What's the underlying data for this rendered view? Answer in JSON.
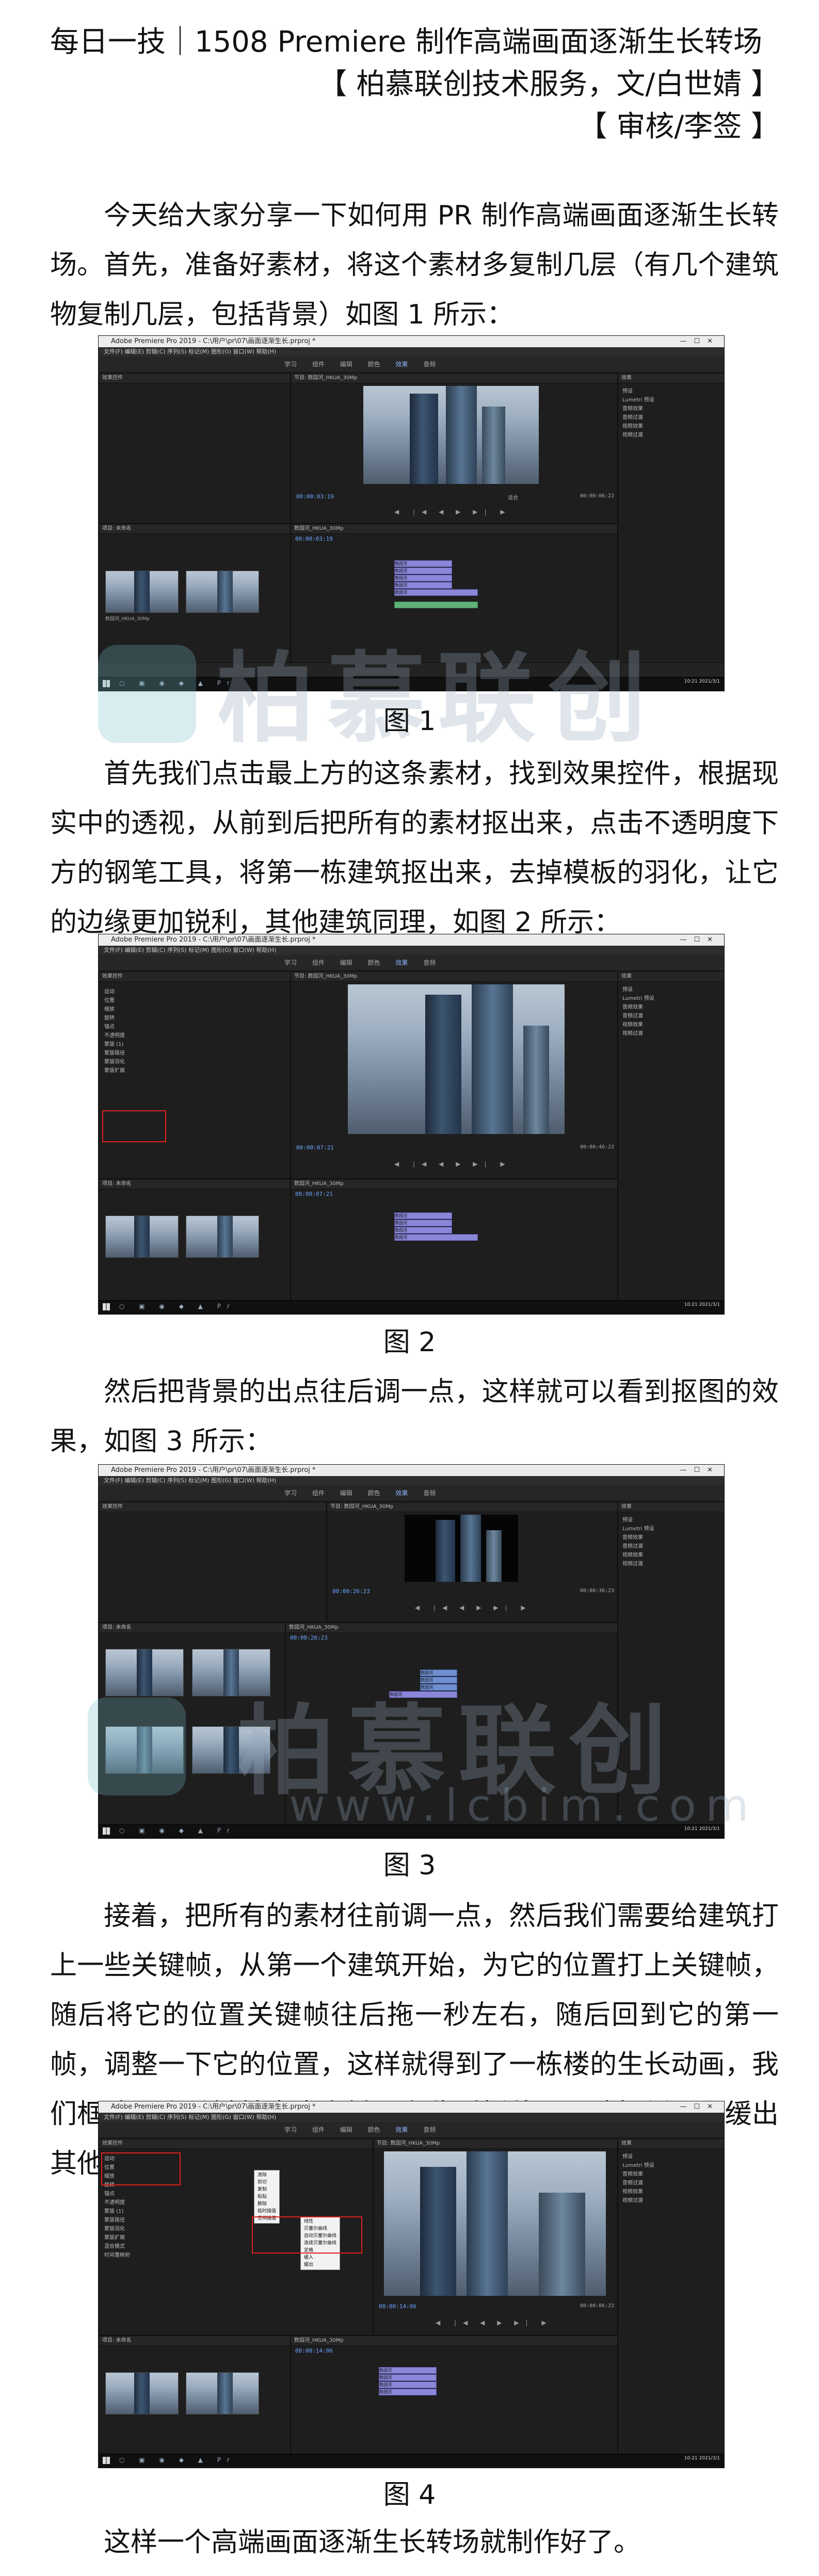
{
  "header": {
    "title": "每日一技｜1508 Premiere 制作高端画面逐渐生长转场",
    "credit": "【 柏慕联创技术服务，文/白世婧 】",
    "review": "【 审核/李签 】"
  },
  "body": {
    "p1": "今天给大家分享一下如何用 PR 制作高端画面逐渐生长转场。",
    "p2": "首先，准备好素材，将这个素材多复制几层（有几个建筑物复制几层，包括背景）如图 1 所示：",
    "fig1_caption": "图 1",
    "p3": "首先我们点击最上方的这条素材，找到效果控件，根据现实中的透视，从前到后把所有的素材抠出来，点击不透明度下方的钢笔工具，将第一栋建筑抠出来，去掉模板的羽化，让它的边缘更加锐利，其他建筑同理，如图 2 所示：",
    "fig2_caption": "图 2",
    "p4": "然后把背景的出点往后调一点，这样就可以看到抠图的效果，如图 3 所示：",
    "fig3_caption": "图 3",
    "p5": "接着，把所有的素材往前调一点，然后我们需要给建筑打上一些关键帧，从第一个建筑开始，为它的位置打上关键帧，随后将它的位置关键帧往后拖一秒左右，随后回到它的第一帧，调整一下它的位置，这样就得到了一栋楼的生长动画，我们框选两个关键帧点击右键，在临时插值里面选择缓入和缓出其他同理，如图 4 所示：",
    "fig4_caption": "图 4",
    "p6": "这样一个高端画面逐渐生长转场就制作好了。"
  },
  "watermark": {
    "brand": "柏慕联创",
    "url": "www.lcbim.com"
  },
  "screenshots": {
    "window_title": "Adobe Premiere Pro 2019 - C:\\用户\\pr\\07\\画面逐渐生长.prproj *",
    "menu": "文件(F)  编辑(E)  剪辑(C)  序列(S)  标记(M)  图形(G)  窗口(W)  帮助(H)",
    "workspaces": [
      "学习",
      "组件",
      "编辑",
      "颜色",
      "效果",
      "音频",
      "图形",
      "库"
    ],
    "active_workspace": "效果",
    "program_tab": "节目: 数园河_HKUA_30Mp",
    "source_tab": "效果控件",
    "project_tab": "项目: 未命名",
    "effects_tab": "效果",
    "effects_list": [
      "预设",
      "Lumetri 预设",
      "音频效果",
      "音频过渡",
      "视频效果",
      "视频过渡"
    ],
    "fit_label": "适合",
    "full_label": "完整",
    "tc_1": "00:00:03:19",
    "tc_1_end": "00:00:06:22",
    "tc_2": "00:00:07:21",
    "tc_2_end": "00:00:46:22",
    "tc_3": "00:00:26:23",
    "tc_3_end": "00:00:36:23",
    "tc_4": "00:00:14:06",
    "tc_4_end": "00:00:06:22",
    "seq_tab": "数园河_HKUA_30Mp",
    "clip_name": "数园河",
    "thumb_name": "数园河_HKUA_30Mp",
    "effect_rows": [
      "运动",
      "位置",
      "缩放",
      "旋转",
      "锚点",
      "不透明度",
      "蒙版 (1)",
      "蒙版路径",
      "蒙版羽化",
      "蒙版扩展",
      "混合模式",
      "时间重映射"
    ],
    "ctx_items_1": [
      "清除",
      "剪切",
      "复制",
      "粘贴",
      "删除"
    ],
    "ctx_items_2": [
      "临时插值",
      "空间插值"
    ],
    "ctx_items_3": [
      "线性",
      "贝塞尔曲线",
      "自动贝塞尔曲线",
      "连续贝塞尔曲线",
      "定格",
      "缓入",
      "缓出"
    ],
    "clock": "10:21\n2021/3/1"
  }
}
